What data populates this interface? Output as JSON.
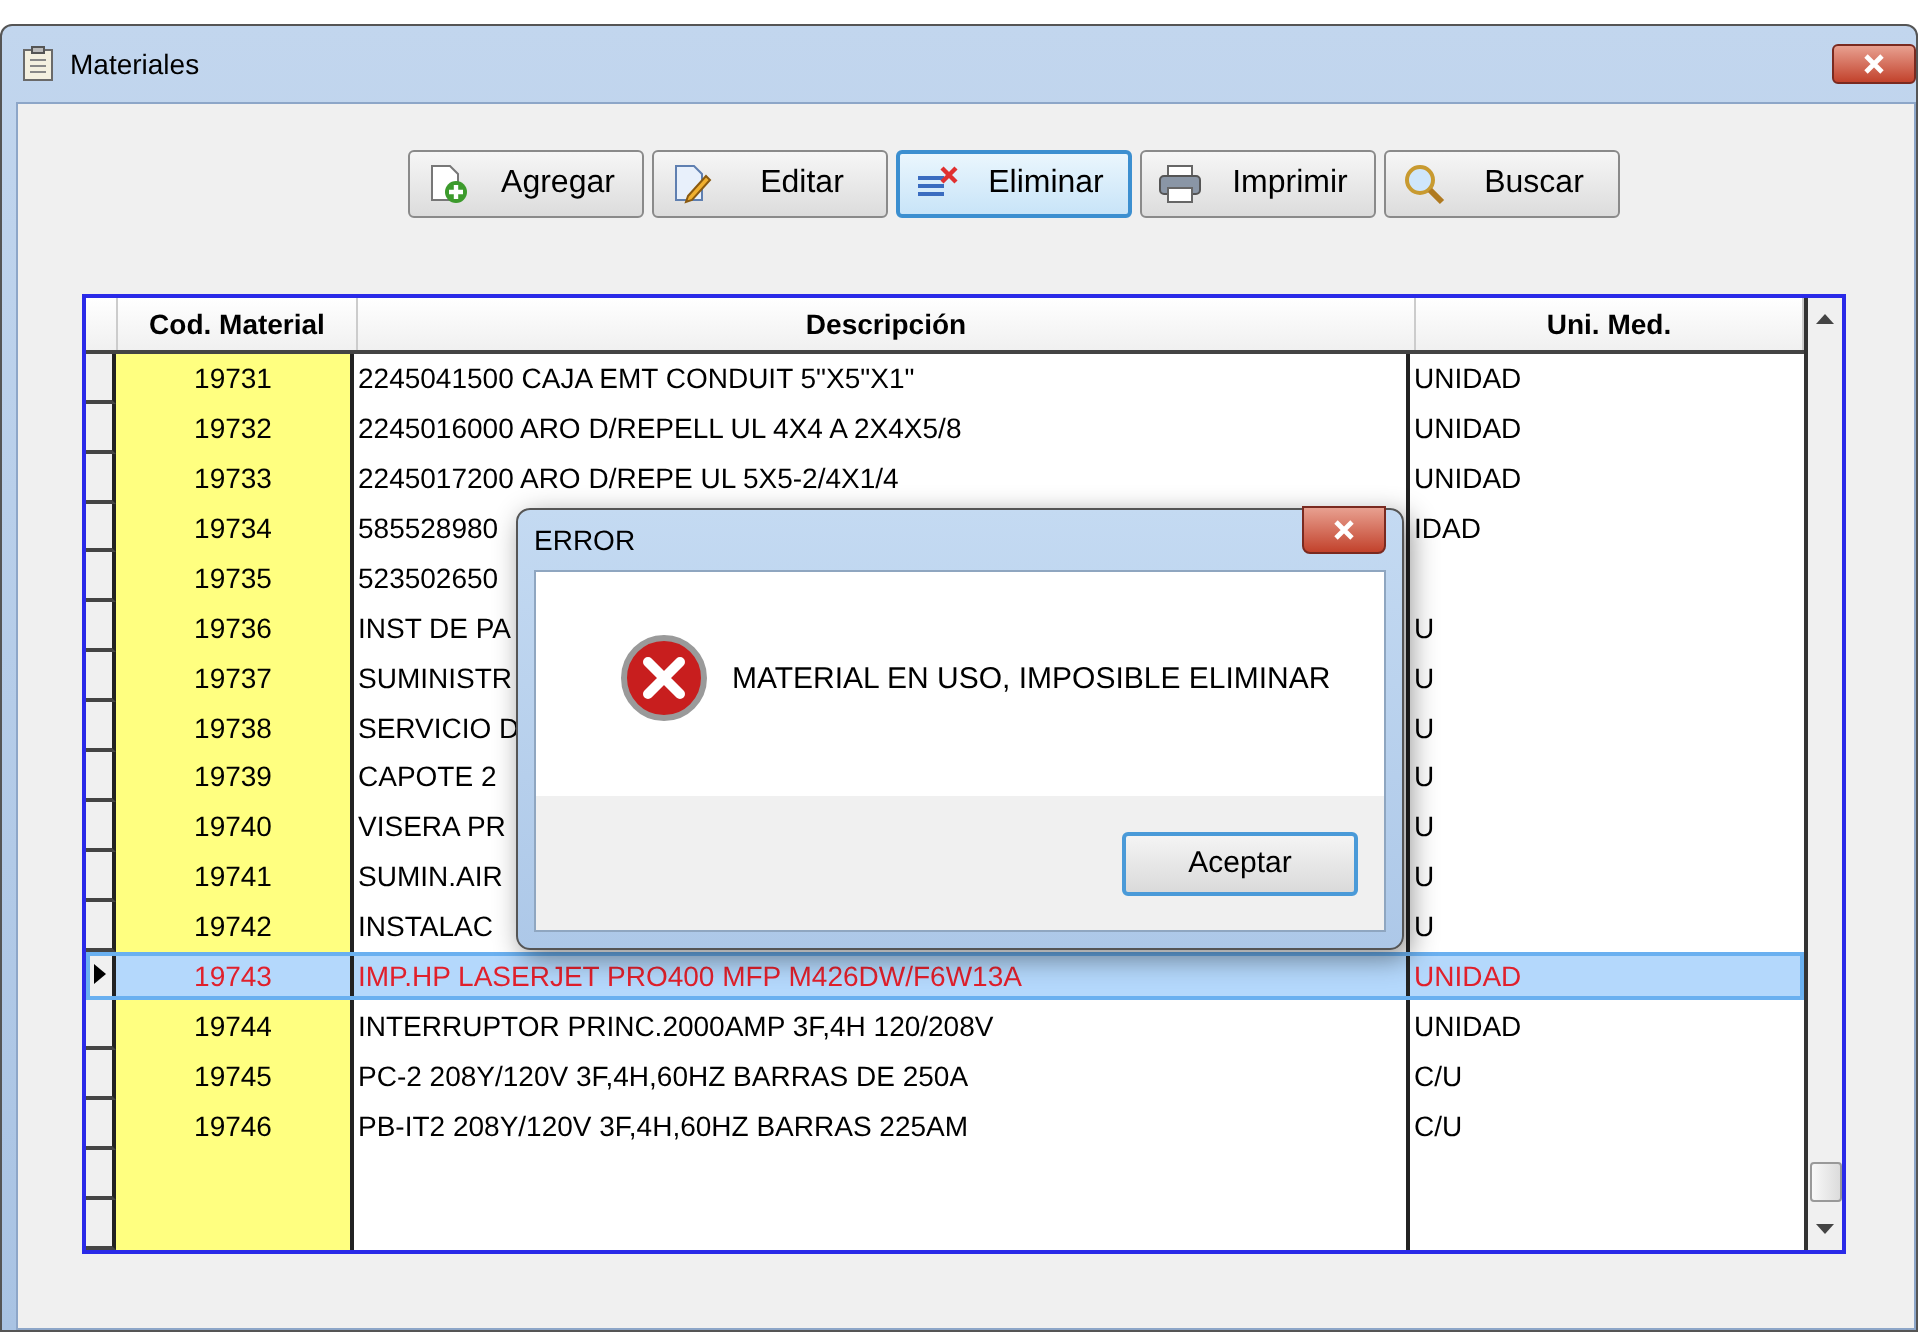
{
  "window": {
    "title": "Materiales"
  },
  "toolbar": [
    {
      "kind": "add",
      "label": "Agregar",
      "focused": false
    },
    {
      "kind": "edit",
      "label": "Editar",
      "focused": false
    },
    {
      "kind": "delete",
      "label": "Eliminar",
      "focused": true
    },
    {
      "kind": "print",
      "label": "Imprimir",
      "focused": false
    },
    {
      "kind": "search",
      "label": "Buscar",
      "focused": false
    }
  ],
  "table": {
    "columns": [
      "Cod. Material",
      "Descripción",
      "Uni. Med."
    ],
    "rows": [
      {
        "code": "19731",
        "description": "2245041500 CAJA EMT CONDUIT 5\"X5\"X1\"",
        "unit": "UNIDAD",
        "selected": false
      },
      {
        "code": "19732",
        "description": "2245016000 ARO D/REPELL UL 4X4 A 2X4X5/8",
        "unit": "UNIDAD",
        "selected": false
      },
      {
        "code": "19733",
        "description": "2245017200 ARO D/REPE UL 5X5-2/4X1/4",
        "unit": "UNIDAD",
        "selected": false
      },
      {
        "code": "19734",
        "description": "585528980",
        "unit": "IDAD",
        "selected": false
      },
      {
        "code": "19735",
        "description": "523502650",
        "selected": false
      },
      {
        "code": "19736",
        "description": "INST DE PA",
        "unit": "U",
        "selected": false
      },
      {
        "code": "19737",
        "description": "SUMINISTR",
        "unit": "U",
        "selected": false
      },
      {
        "code": "19738",
        "description": "SERVICIO D",
        "unit": "U",
        "selected": false
      },
      {
        "code": "19739",
        "description": "CAPOTE 2",
        "unit": "U",
        "selected": false
      },
      {
        "code": "19740",
        "description": "VISERA PR",
        "unit": "U",
        "selected": false
      },
      {
        "code": "19741",
        "description": "SUMIN.AIR",
        "unit": "U",
        "selected": false
      },
      {
        "code": "19742",
        "description": "INSTALAC",
        "unit": "U",
        "selected": false
      },
      {
        "code": "19743",
        "description": "IMP.HP LASERJET PRO400 MFP M426DW/F6W13A",
        "unit": "UNIDAD",
        "selected": true
      },
      {
        "code": "19744",
        "description": "INTERRUPTOR PRINC.2000AMP 3F,4H 120/208V",
        "unit": "UNIDAD",
        "selected": false
      },
      {
        "code": "19745",
        "description": "PC-2 208Y/120V 3F,4H,60HZ BARRAS DE 250A",
        "unit": "C/U",
        "selected": false
      },
      {
        "code": "19746",
        "description": "PB-IT2 208Y/120V 3F,4H,60HZ BARRAS 225AM",
        "unit": "C/U",
        "selected": false
      }
    ]
  },
  "dialog": {
    "title": "ERROR",
    "message": "MATERIAL EN USO, IMPOSIBLE ELIMINAR",
    "button": "Aceptar"
  }
}
